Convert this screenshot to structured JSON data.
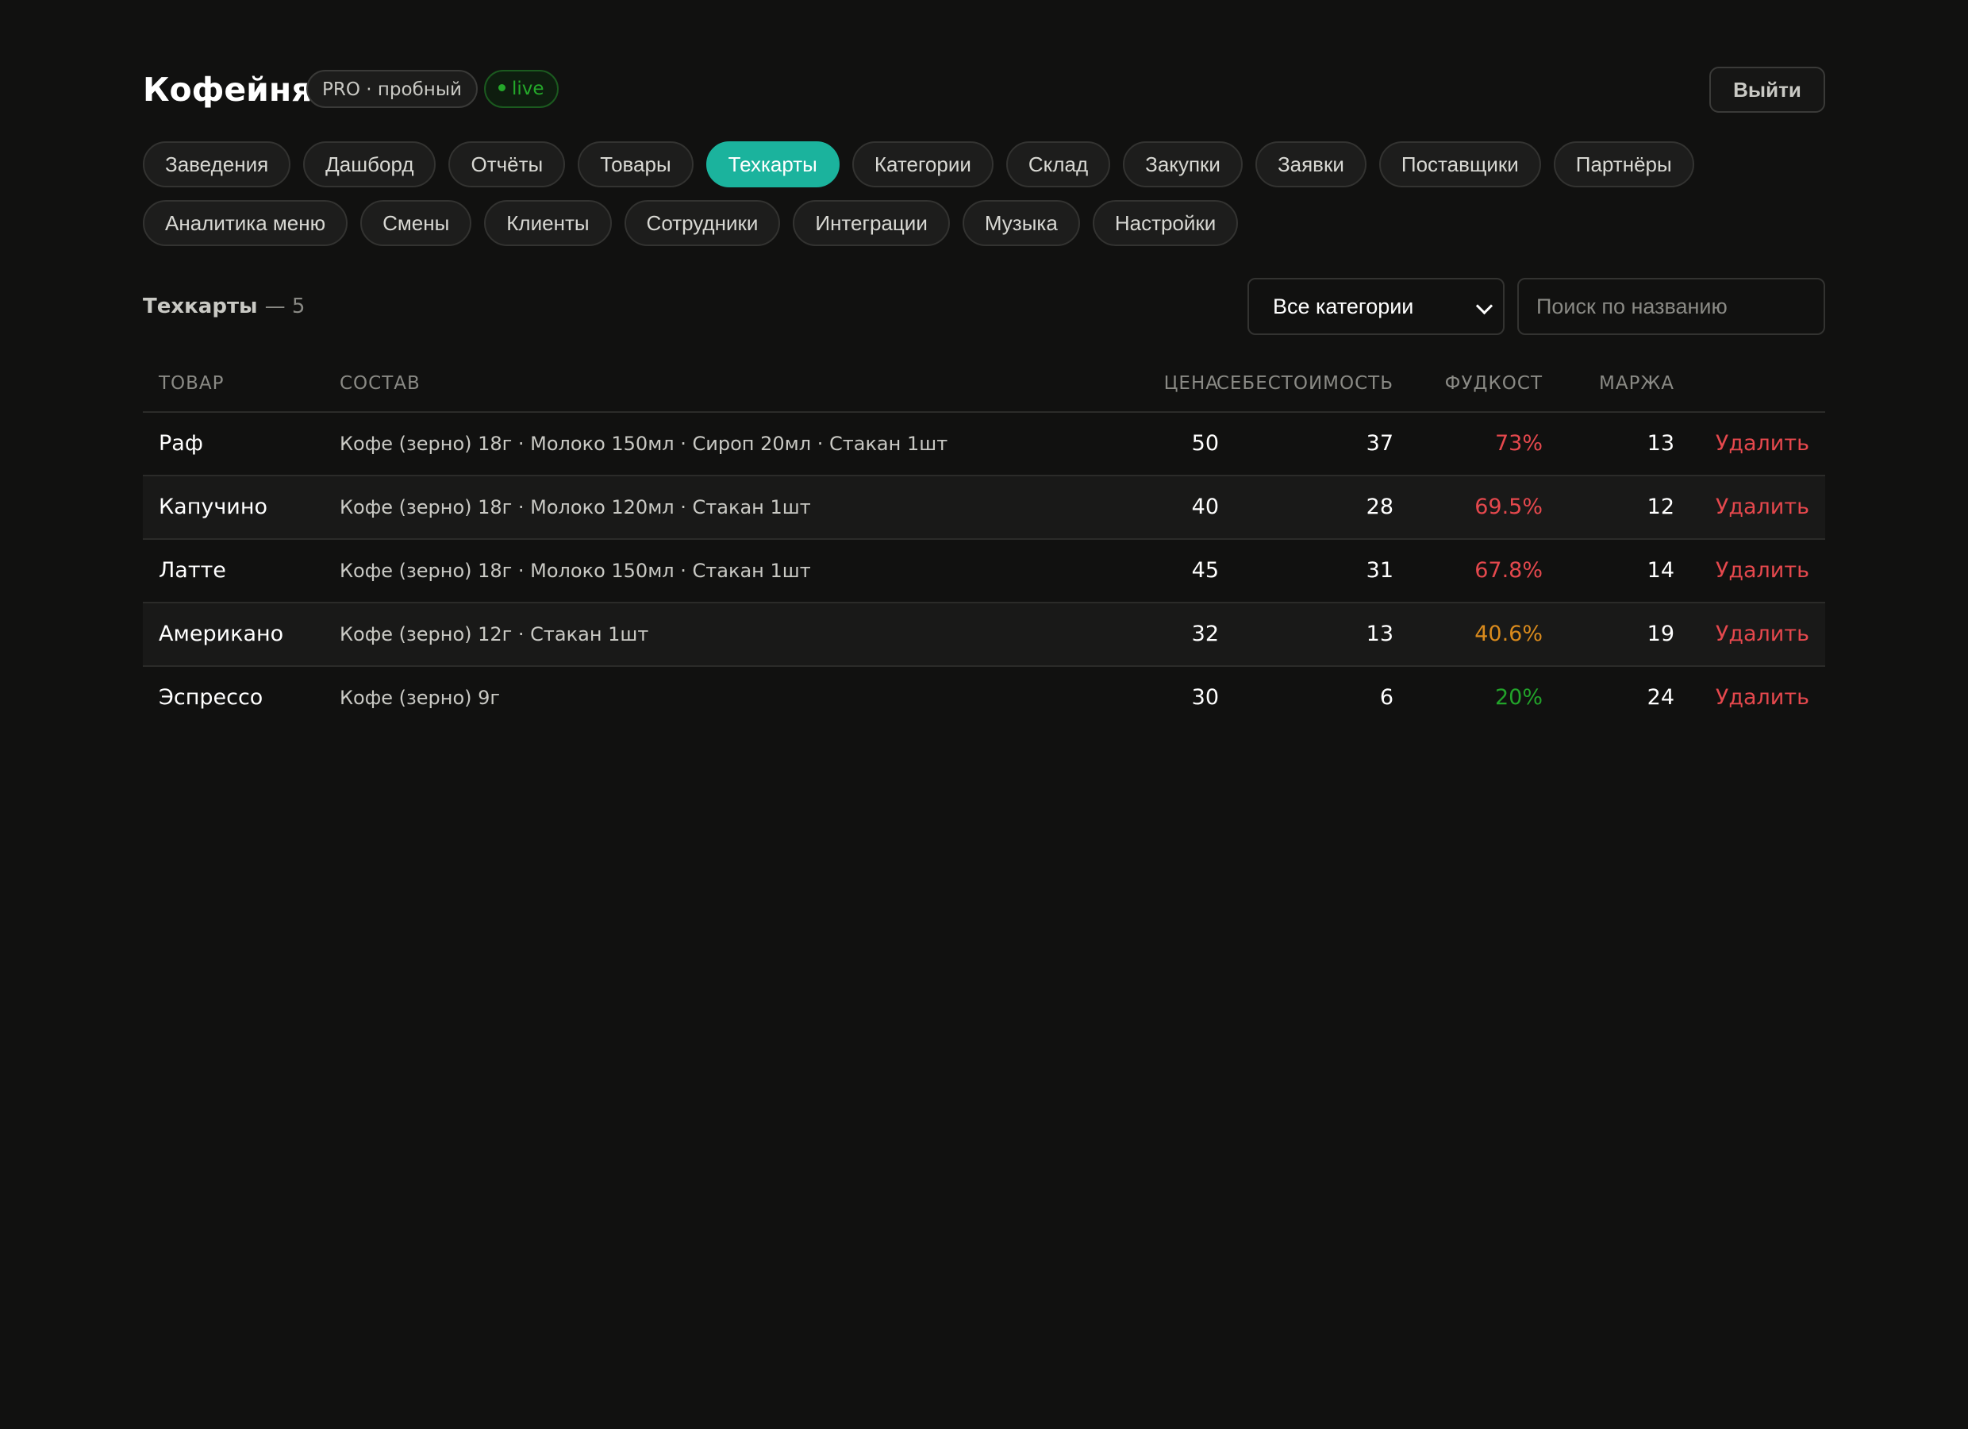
{
  "header": {
    "brand": "Кофейня",
    "plan_badge": "PRO · пробный",
    "live_badge": "live",
    "logout_label": "Выйти"
  },
  "nav": {
    "row1": [
      {
        "label": "Заведения",
        "active": false
      },
      {
        "label": "Дашборд",
        "active": false
      },
      {
        "label": "Отчёты",
        "active": false
      },
      {
        "label": "Товары",
        "active": false
      },
      {
        "label": "Техкарты",
        "active": true
      },
      {
        "label": "Категории",
        "active": false
      },
      {
        "label": "Склад",
        "active": false
      },
      {
        "label": "Закупки",
        "active": false
      },
      {
        "label": "Заявки",
        "active": false
      },
      {
        "label": "Поставщики",
        "active": false
      },
      {
        "label": "Партнёры",
        "active": false
      }
    ],
    "row2": [
      {
        "label": "Аналитика меню",
        "active": false
      },
      {
        "label": "Смены",
        "active": false
      },
      {
        "label": "Клиенты",
        "active": false
      },
      {
        "label": "Сотрудники",
        "active": false
      },
      {
        "label": "Интеграции",
        "active": false
      },
      {
        "label": "Музыка",
        "active": false
      },
      {
        "label": "Настройки",
        "active": false
      }
    ]
  },
  "toolbar": {
    "title": "Техкарты",
    "count": "— 5",
    "category_select": "Все категории",
    "search_placeholder": "Поиск по названию"
  },
  "table": {
    "headers": {
      "name": "ТОВАР",
      "composition": "СОСТАВ",
      "price": "ЦЕНА",
      "cost": "СЕБЕСТОИМОСТЬ",
      "foodcost": "ФУДКОСТ",
      "margin": "МАРЖА"
    },
    "delete_label": "Удалить",
    "rows": [
      {
        "name": "Раф",
        "composition": "Кофе (зерно) 18г · Молоко 150мл · Сироп 20мл · Стакан 1шт",
        "price": "50",
        "cost": "37",
        "foodcost": "73%",
        "foodcost_color": "#e5484d",
        "margin": "13"
      },
      {
        "name": "Капучино",
        "composition": "Кофе (зерно) 18г · Молоко 120мл · Стакан 1шт",
        "price": "40",
        "cost": "28",
        "foodcost": "69.5%",
        "foodcost_color": "#e5484d",
        "margin": "12"
      },
      {
        "name": "Латте",
        "composition": "Кофе (зерно) 18г · Молоко 150мл · Стакан 1шт",
        "price": "45",
        "cost": "31",
        "foodcost": "67.8%",
        "foodcost_color": "#e5484d",
        "margin": "14"
      },
      {
        "name": "Американо",
        "composition": "Кофе (зерно) 12г · Стакан 1шт",
        "price": "32",
        "cost": "13",
        "foodcost": "40.6%",
        "foodcost_color": "#d98a1c",
        "margin": "19"
      },
      {
        "name": "Эспрессо",
        "composition": "Кофе (зерно) 9г",
        "price": "30",
        "cost": "6",
        "foodcost": "20%",
        "foodcost_color": "#22a32a",
        "margin": "24"
      }
    ]
  },
  "colors": {
    "background": "#111110",
    "accent": "#1bb39d",
    "danger": "#e5484d",
    "warning": "#d98a1c",
    "success": "#22a32a"
  }
}
